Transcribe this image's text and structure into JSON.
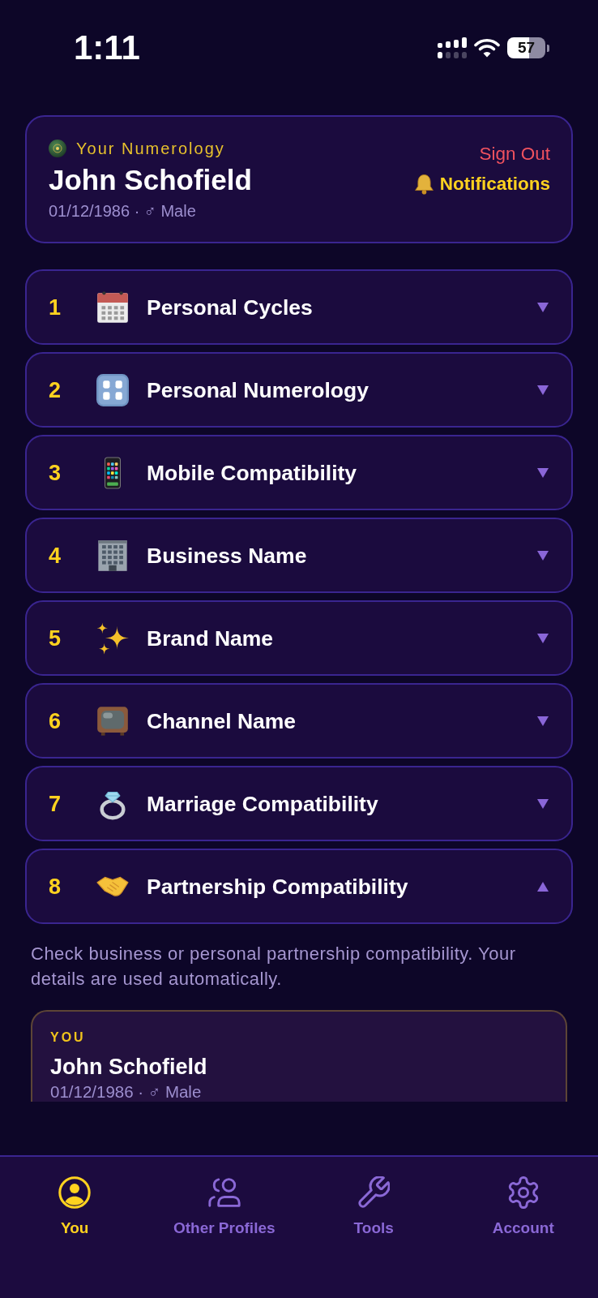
{
  "status_bar": {
    "time": "1:11",
    "battery": "57"
  },
  "profile_card": {
    "label": "Your Numerology",
    "name": "John Schofield",
    "details": "01/12/1986 · ♂ Male",
    "sign_out": "Sign Out",
    "notifications": "Notifications"
  },
  "sections": [
    {
      "number": "1",
      "title": "Personal Cycles",
      "expanded": false
    },
    {
      "number": "2",
      "title": "Personal Numerology",
      "expanded": false
    },
    {
      "number": "3",
      "title": "Mobile Compatibility",
      "expanded": false
    },
    {
      "number": "4",
      "title": "Business Name",
      "expanded": false
    },
    {
      "number": "5",
      "title": "Brand Name",
      "expanded": false
    },
    {
      "number": "6",
      "title": "Channel Name",
      "expanded": false
    },
    {
      "number": "7",
      "title": "Marriage Compatibility",
      "expanded": false
    },
    {
      "number": "8",
      "title": "Partnership Compatibility",
      "expanded": true,
      "description": "Check business or personal partnership compatibility. Your details are used automatically.",
      "person_card": {
        "label": "YOU",
        "name": "John Schofield",
        "details": "01/12/1986 · ♂ Male"
      }
    }
  ],
  "tab_bar": [
    {
      "label": "You",
      "selected": true
    },
    {
      "label": "Other Profiles",
      "selected": false
    },
    {
      "label": "Tools",
      "selected": false
    },
    {
      "label": "Account",
      "selected": false
    }
  ]
}
